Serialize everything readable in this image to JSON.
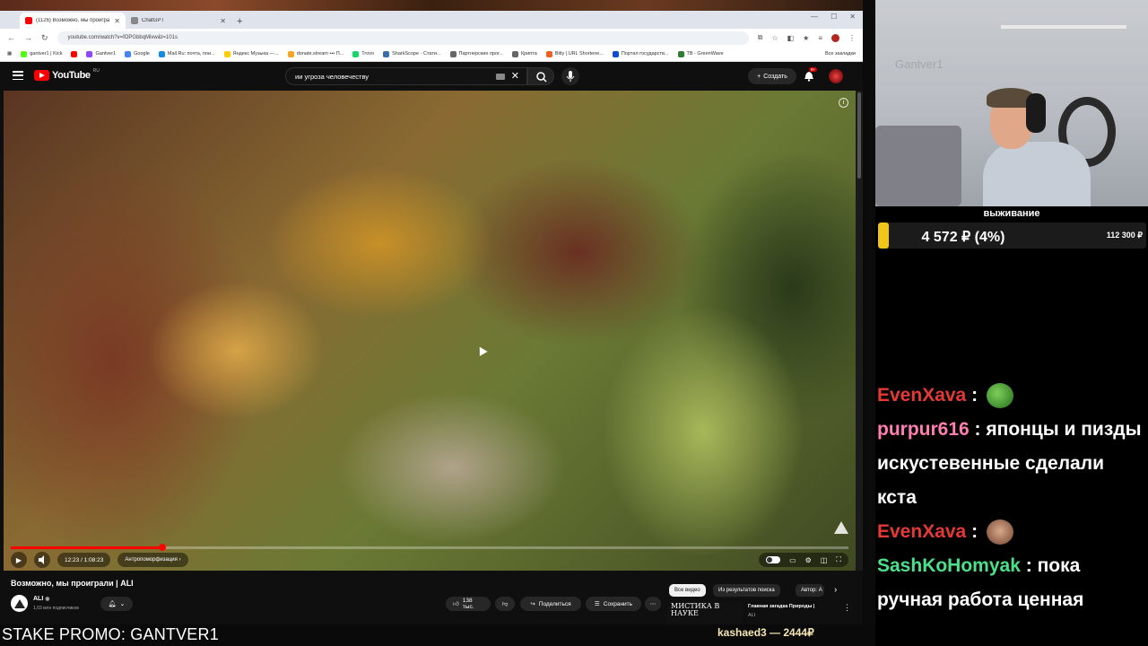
{
  "browser": {
    "tabs": [
      {
        "title": "(1126) Возможно, мы проигра",
        "active": true,
        "favicon_color": "#ff0000"
      },
      {
        "title": "ChatGPT",
        "active": false,
        "favicon_color": "#888888"
      }
    ],
    "url": "youtube.com/watch?v=fOPGbbqMivw&t=101s",
    "bookmarks": [
      {
        "label": "gantver1 | Kick",
        "icon_color": "#53fc18"
      },
      {
        "label": "",
        "icon_color": "#ff0000"
      },
      {
        "label": "Gantver1",
        "icon_color": "#9146ff"
      },
      {
        "label": "Google",
        "icon_color": "#4285f4"
      },
      {
        "label": "Mail.Ru: почта, пои...",
        "icon_color": "#168de2"
      },
      {
        "label": "Яндекс Музыка —...",
        "icon_color": "#ffcc00"
      },
      {
        "label": "donate.stream ••• П...",
        "icon_color": "#f5a623"
      },
      {
        "label": "Trovo",
        "icon_color": "#19d66b"
      },
      {
        "label": "SharkScope · Стати...",
        "icon_color": "#3a6ea5"
      },
      {
        "label": "Партнерские прог...",
        "icon_color": "#666666"
      },
      {
        "label": "Крипта",
        "icon_color": "#666666"
      },
      {
        "label": "Bitly | URL Shortene...",
        "icon_color": "#ee6123"
      },
      {
        "label": "Портал государств...",
        "icon_color": "#0d4cd3"
      },
      {
        "label": "TB - GreenWave",
        "icon_color": "#2e7d32"
      }
    ],
    "all_bookmarks": "Все закладки"
  },
  "youtube": {
    "logo_text": "YouTube",
    "logo_region": "RU",
    "search_value": "ии угроза человечеству",
    "create_label": "Создать",
    "notifications_badge": "9+",
    "player": {
      "time": "12:23 / 1:08:23",
      "chapter": "Антропоморфизация",
      "progress": 0.181
    },
    "video_title": "Возможно, мы проиграли | ALI",
    "channel_name": "ALI",
    "channel_subs": "1,03 млн подписчиков",
    "likes": "138 тыс.",
    "share_label": "Поделиться",
    "save_label": "Сохранить",
    "filters": [
      "Все видео",
      "Из результатов поиска",
      "Автор: А"
    ],
    "rec": {
      "thumb_text": "МИСТИКА В НАУКЕ",
      "title": "Главная загадка Природы |",
      "channel": "ALI"
    }
  },
  "stream": {
    "promo": "STAKE PROMO: GANTVER1",
    "last_donation": "kashaed3 — 2444₽",
    "webcam_wall_text": "Gantver1",
    "goal": {
      "label": "выживание",
      "amount": "4 572 ₽ (4%)",
      "target": "112 300 ₽",
      "fraction": 0.04,
      "color": "#f0c419"
    },
    "chat": [
      {
        "user": "EvenXava",
        "color": "#e53935",
        "text": "",
        "emote": "pepe"
      },
      {
        "user": "purpur616",
        "color": "#ff7fb0",
        "text": "японцы и пизды искустевенные сделали кста",
        "emote": ""
      },
      {
        "user": "EvenXava",
        "color": "#e53935",
        "text": "",
        "emote": "face"
      },
      {
        "user": "SashKoHomyak",
        "color": "#4be08a",
        "text": "пока ручная работа ценная",
        "emote": ""
      }
    ]
  }
}
